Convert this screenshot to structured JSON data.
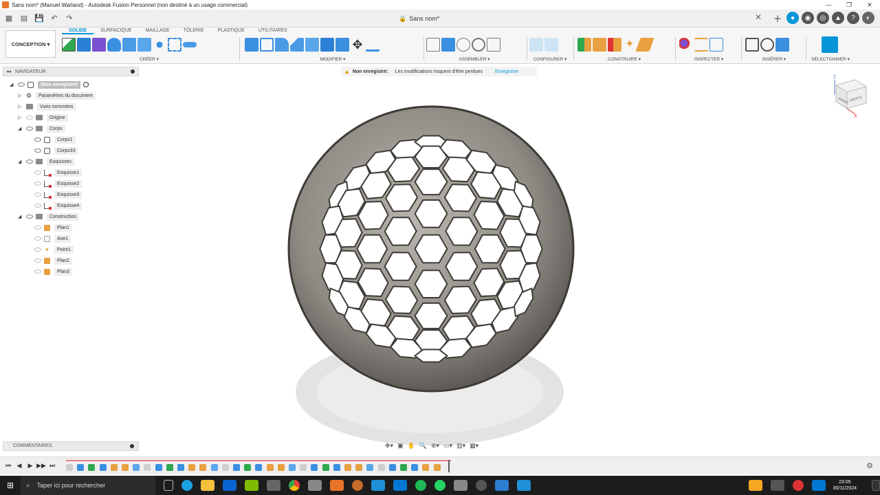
{
  "titlebar": {
    "title": "Sans nom* (Manuel Warland) - Autodesk Fusion Personnel (non destiné à un usage commercial)"
  },
  "doc_tab": {
    "name": "Sans nom*"
  },
  "workspace": {
    "label": "CONCEPTION ▾"
  },
  "ribbon_tabs": [
    "SOLIDE",
    "SURFACIQUE",
    "MAILLAGE",
    "TÔLERIE",
    "PLASTIQUE",
    "UTILITAIRES"
  ],
  "tool_groups": {
    "creer": "CRÉER ▾",
    "modifier": "MODIFIER ▾",
    "assembler": "ASSEMBLER ▾",
    "configurer": "CONFIGURER ▾",
    "construire": "CONSTRUIRE ▾",
    "inspecter": "INSPECTER ▾",
    "inserer": "INSÉRER ▾",
    "selectionner": "SÉLECTIONNER ▾"
  },
  "navigator": {
    "header": "NAVIGATEUR",
    "root": "(Non enregistré)",
    "items": {
      "params": "Paramètres du document",
      "views": "Vues nommées",
      "origin": "Origine",
      "bodies": "Corps",
      "body1": "Corps1",
      "body33": "Corps33",
      "sketches": "Esquisses",
      "sketch1": "Esquisse1",
      "sketch2": "Esquisse2",
      "sketch3": "Esquisse3",
      "sketch4": "Esquisse4",
      "construction": "Construction",
      "plane1": "Plan1",
      "axis1": "Axe1",
      "point1": "Point1",
      "plane2": "Plan2",
      "plane3": "Plan3"
    }
  },
  "save_warning": {
    "title": "Non enregistré:",
    "message": "Les modifications risquent d'être perdues",
    "action": "Enregistrer"
  },
  "viewcube": {
    "front": "AVANT",
    "right": "DROITE",
    "z": "Z",
    "x": "X"
  },
  "comments": {
    "label": "COMMENTAIRES"
  },
  "taskbar": {
    "search_placeholder": "Taper ici pour rechercher",
    "time": "23:05",
    "date": "30/11/2024"
  },
  "colors": {
    "accent": "#0696d7",
    "fusion_orange": "#e8742a",
    "model": "#8e8a84"
  }
}
